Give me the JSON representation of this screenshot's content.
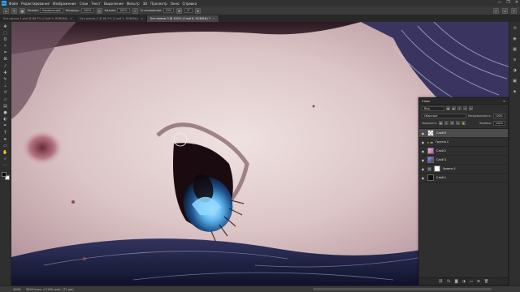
{
  "app": {
    "logo": "Ps"
  },
  "menu": [
    "Файл",
    "Редактирование",
    "Изображение",
    "Слои",
    "Текст",
    "Выделение",
    "Фильтр",
    "3D",
    "Просмотр",
    "Окно",
    "Справка"
  ],
  "window_controls": {
    "minimize": "—",
    "maximize": "❐",
    "close": "✕"
  },
  "options": {
    "mode_label": "Режим:",
    "mode_value": "Нормальный",
    "opacity_label": "Непрозр.:",
    "opacity_value": "100%",
    "flow_label": "Нажим:",
    "flow_value": "100%",
    "smoothing_label": "Сглаживание:",
    "smoothing_value": "10%",
    "angle_value": "0°"
  },
  "tabs": [
    {
      "label": "Без имени-1.psd @ 66,7% (Слой 5, RGB/8#)",
      "active": false
    },
    {
      "label": "Без имени-2 @ 66,7% (Слой 2, RGB/8#)",
      "active": false
    },
    {
      "label": "Без имени-3 @ 400% (Слой 6, RGB/8#) *",
      "active": true
    }
  ],
  "tools": [
    {
      "name": "move-tool-icon",
      "glyph": "✥"
    },
    {
      "name": "marquee-tool-icon",
      "glyph": "⬚"
    },
    {
      "name": "lasso-tool-icon",
      "glyph": "ʘ"
    },
    {
      "name": "magic-wand-tool-icon",
      "glyph": "✧"
    },
    {
      "name": "crop-tool-icon",
      "glyph": "⌗"
    },
    {
      "name": "frame-tool-icon",
      "glyph": "⊠"
    },
    {
      "name": "eyedropper-tool-icon",
      "glyph": "⁄"
    },
    {
      "name": "healing-brush-tool-icon",
      "glyph": "✚"
    },
    {
      "name": "brush-tool-icon",
      "glyph": "✎"
    },
    {
      "name": "clone-stamp-tool-icon",
      "glyph": "⊥"
    },
    {
      "name": "history-brush-tool-icon",
      "glyph": "↺"
    },
    {
      "name": "eraser-tool-icon",
      "glyph": "▱"
    },
    {
      "name": "gradient-tool-icon",
      "glyph": "▤"
    },
    {
      "name": "blur-tool-icon",
      "glyph": "●"
    },
    {
      "name": "dodge-tool-icon",
      "glyph": "◐"
    },
    {
      "name": "pen-tool-icon",
      "glyph": "✒"
    },
    {
      "name": "type-tool-icon",
      "glyph": "T"
    },
    {
      "name": "path-selection-tool-icon",
      "glyph": "➤"
    },
    {
      "name": "shape-tool-icon",
      "glyph": "▭"
    },
    {
      "name": "hand-tool-icon",
      "glyph": "✋"
    },
    {
      "name": "zoom-tool-icon",
      "glyph": "⌕"
    },
    {
      "name": "more-tools-icon",
      "glyph": "⋯"
    }
  ],
  "right_dock": [
    {
      "name": "history-panel-icon",
      "glyph": "⟲"
    },
    {
      "name": "color-panel-icon",
      "glyph": "◉"
    },
    {
      "name": "swatches-panel-icon",
      "glyph": "▦"
    },
    {
      "name": "properties-panel-icon",
      "glyph": "≡"
    },
    {
      "name": "adjustments-panel-icon",
      "glyph": "◑"
    },
    {
      "name": "libraries-panel-icon",
      "glyph": "▣"
    },
    {
      "name": "layers-panel-icon",
      "glyph": "◈"
    }
  ],
  "layers_panel": {
    "title": "Слои",
    "kind_filter": "Вид",
    "blend_mode": "Обычные",
    "opacity_label": "Непрозрачность:",
    "opacity_value": "100%",
    "lock_label": "Закрепить:",
    "fill_label": "Заливка:",
    "fill_value": "100%",
    "layers": [
      {
        "name": "Слой 6",
        "kind": "checker",
        "active": true,
        "visible": true
      },
      {
        "name": "Группа 1",
        "kind": "folder",
        "active": false,
        "visible": true
      },
      {
        "name": "Слой 2",
        "kind": "pink",
        "active": false,
        "visible": true
      },
      {
        "name": "Слой 3",
        "kind": "purple",
        "active": false,
        "visible": true
      },
      {
        "name": "Уровни 1",
        "kind": "adjust",
        "active": false,
        "visible": true
      },
      {
        "name": "Слой 1",
        "kind": "dark",
        "active": false,
        "visible": true
      }
    ]
  },
  "status": {
    "zoom": "400%",
    "doc": "3840 пикс. x 2160 пикс. (72 ppi)"
  }
}
